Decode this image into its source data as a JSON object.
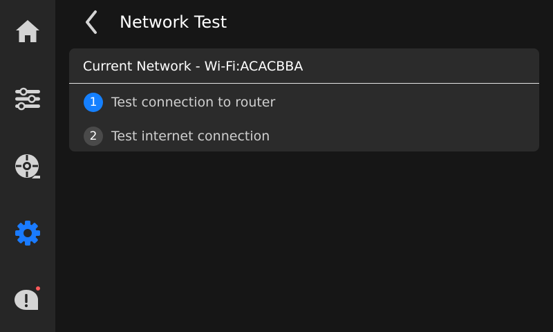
{
  "header": {
    "title": "Network Test"
  },
  "sidebar": {
    "items": [
      {
        "icon": "home-icon",
        "selected": false
      },
      {
        "icon": "sliders-icon",
        "selected": false
      },
      {
        "icon": "extruder-icon",
        "selected": false
      },
      {
        "icon": "gear-icon",
        "selected": true
      },
      {
        "icon": "alert-icon",
        "selected": false,
        "has_notification": true
      }
    ]
  },
  "card": {
    "header": "Current Network - Wi-Fi:ACACBBA",
    "steps": [
      {
        "number": "1",
        "label": "Test connection to router",
        "state": "active"
      },
      {
        "number": "2",
        "label": "Test internet connection",
        "state": "pending"
      }
    ]
  },
  "colors": {
    "background": "#161616",
    "sidebar": "#262626",
    "card": "#2b2b2b",
    "accent": "#1580ff",
    "notification_dot": "#ff5a5a"
  }
}
